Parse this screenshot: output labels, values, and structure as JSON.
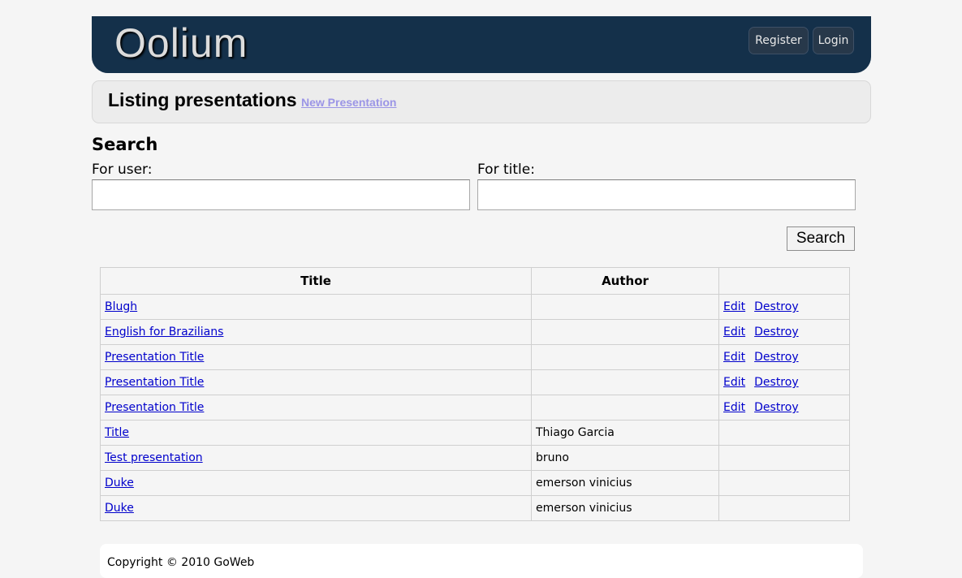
{
  "header": {
    "logo": "Oolium",
    "register_label": "Register",
    "login_label": "Login",
    "bg_color": "#14304a"
  },
  "titlebar": {
    "title": "Listing presentations",
    "new_link": "New Presentation"
  },
  "search": {
    "heading": "Search",
    "user_label": "For user:",
    "user_value": "",
    "title_label": "For title:",
    "title_value": "",
    "button_label": "Search"
  },
  "table": {
    "headers": [
      "Title",
      "Author",
      ""
    ],
    "rows": [
      {
        "title": "Blugh",
        "author": "",
        "edit": "Edit",
        "destroy": "Destroy"
      },
      {
        "title": "English for Brazilians",
        "author": "",
        "edit": "Edit",
        "destroy": "Destroy"
      },
      {
        "title": "Presentation Title",
        "author": "",
        "edit": "Edit",
        "destroy": "Destroy"
      },
      {
        "title": "Presentation Title",
        "author": "",
        "edit": "Edit",
        "destroy": "Destroy"
      },
      {
        "title": "Presentation Title",
        "author": "",
        "edit": "Edit",
        "destroy": "Destroy"
      },
      {
        "title": "Title",
        "author": "Thiago Garcia",
        "edit": "",
        "destroy": ""
      },
      {
        "title": "Test presentation",
        "author": "bruno",
        "edit": "",
        "destroy": ""
      },
      {
        "title": "Duke",
        "author": "emerson vinicius",
        "edit": "",
        "destroy": ""
      },
      {
        "title": "Duke",
        "author": "emerson vinicius",
        "edit": "",
        "destroy": ""
      }
    ]
  },
  "footer": {
    "copyright": "Copyright © 2010 GoWeb"
  }
}
